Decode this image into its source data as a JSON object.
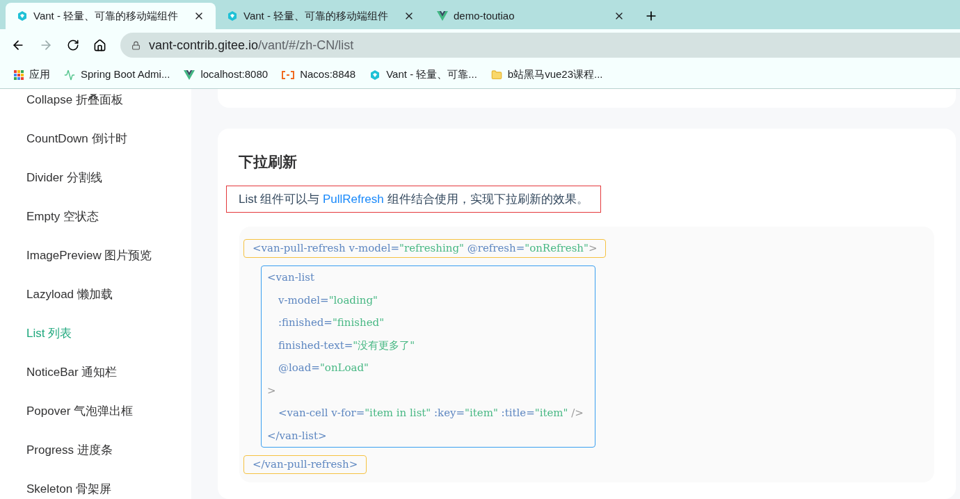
{
  "tabs": [
    {
      "title": "Vant - 轻量、可靠的移动端组件",
      "kind": "vant",
      "selected": true
    },
    {
      "title": "Vant - 轻量、可靠的移动端组件",
      "kind": "vant",
      "selected": false
    },
    {
      "title": "demo-toutiao",
      "kind": "vue",
      "selected": false
    }
  ],
  "address": {
    "host": "vant-contrib.gitee.io",
    "path": "/vant/#/zh-CN/list"
  },
  "bookmarks": [
    {
      "label": "应用",
      "kind": "apps"
    },
    {
      "label": "Spring Boot Admi...",
      "kind": "pulse"
    },
    {
      "label": "localhost:8080",
      "kind": "vue"
    },
    {
      "label": "Nacos:8848",
      "kind": "nacos"
    },
    {
      "label": "Vant - 轻量、可靠...",
      "kind": "vant"
    },
    {
      "label": "b站黑马vue23课程...",
      "kind": "folder"
    }
  ],
  "sidebar": {
    "items": [
      {
        "label": "Collapse 折叠面板",
        "selected": false
      },
      {
        "label": "CountDown 倒计时",
        "selected": false
      },
      {
        "label": "Divider 分割线",
        "selected": false
      },
      {
        "label": "Empty 空状态",
        "selected": false
      },
      {
        "label": "ImagePreview 图片预览",
        "selected": false
      },
      {
        "label": "Lazyload 懒加载",
        "selected": false
      },
      {
        "label": "List 列表",
        "selected": true
      },
      {
        "label": "NoticeBar 通知栏",
        "selected": false
      },
      {
        "label": "Popover 气泡弹出框",
        "selected": false
      },
      {
        "label": "Progress 进度条",
        "selected": false
      },
      {
        "label": "Skeleton 骨架屏",
        "selected": false
      }
    ]
  },
  "section": {
    "title": "下拉刷新",
    "text_before": "List 组件可以与 ",
    "link": "PullRefresh",
    "text_after": " 组件结合使用，实现下拉刷新的效果。",
    "code": [
      {
        "kind": "line",
        "tokens": [
          {
            "t": "<van-pull-refresh v-model=",
            "kind": "tag"
          },
          {
            "t": "\"refreshing\"",
            "kind": "str"
          },
          {
            "t": " @refresh=",
            "kind": "tag"
          },
          {
            "t": "\"onRefresh\"",
            "kind": "str"
          },
          {
            "t": ">",
            "kind": "punct"
          }
        ]
      },
      {
        "kind": "group",
        "lines": [
          {
            "kind": "tag",
            "tokens": [
              {
                "t": "<van-list",
                "kind": "tag"
              }
            ]
          },
          {
            "kind": "attr",
            "tokens": [
              {
                "t": "v-model=",
                "kind": "tag"
              },
              {
                "t": "\"loading\"",
                "kind": "str"
              }
            ]
          },
          {
            "kind": "attr",
            "tokens": [
              {
                "t": ":finished=",
                "kind": "tag"
              },
              {
                "t": "\"finished\"",
                "kind": "str"
              }
            ]
          },
          {
            "kind": "attr",
            "tokens": [
              {
                "t": "finished-text=",
                "kind": "tag"
              },
              {
                "t": "\"没有更多了\"",
                "kind": "str"
              }
            ]
          },
          {
            "kind": "attr",
            "tokens": [
              {
                "t": "@load=",
                "kind": "tag"
              },
              {
                "t": "\"onLoad\"",
                "kind": "str"
              }
            ]
          },
          {
            "kind": "tag",
            "tokens": [
              {
                "t": ">",
                "kind": "punct"
              }
            ]
          },
          {
            "kind": "attr",
            "tokens": [
              {
                "t": "<van-cell v-for=",
                "kind": "tag"
              },
              {
                "t": "\"item in list\"",
                "kind": "str"
              },
              {
                "t": " :key=",
                "kind": "tag"
              },
              {
                "t": "\"item\"",
                "kind": "str"
              },
              {
                "t": " :title=",
                "kind": "tag"
              },
              {
                "t": "\"item\"",
                "kind": "str"
              },
              {
                "t": " />",
                "kind": "punct"
              }
            ]
          },
          {
            "kind": "tag",
            "tokens": [
              {
                "t": "</van-list>",
                "kind": "tag"
              }
            ]
          }
        ]
      },
      {
        "kind": "line",
        "tokens": [
          {
            "t": "</van-pull-refresh>",
            "kind": "tag"
          }
        ]
      }
    ]
  }
}
